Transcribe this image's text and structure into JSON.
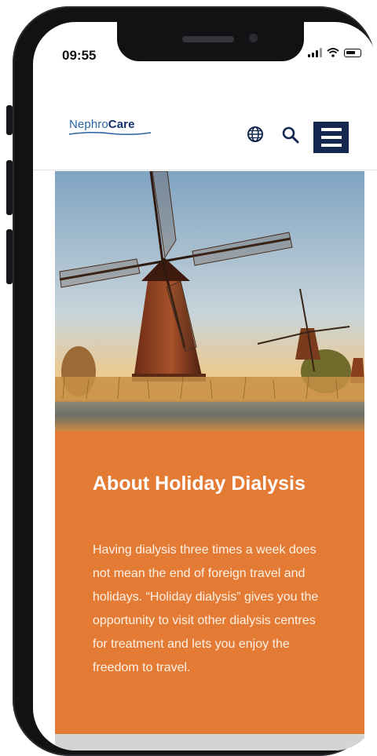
{
  "status_bar": {
    "time": "09:55"
  },
  "header": {
    "logo_part1": "Nephro",
    "logo_part2": "Care",
    "icons": [
      "globe-icon",
      "search-icon",
      "hamburger-menu-icon"
    ]
  },
  "hero": {
    "image": "windmills-at-sunset"
  },
  "article": {
    "title": "About Holiday Dialysis",
    "body": "Having dialysis three times a week does not mean the end of foreign travel and holidays. “Holiday dialysis” gives you the opportunity to visit other dialysis centres for treatment and lets you enjoy the freedom to travel."
  },
  "colors": {
    "accent": "#e47b34",
    "menu": "#14284f",
    "logo": "#2b63a7"
  }
}
